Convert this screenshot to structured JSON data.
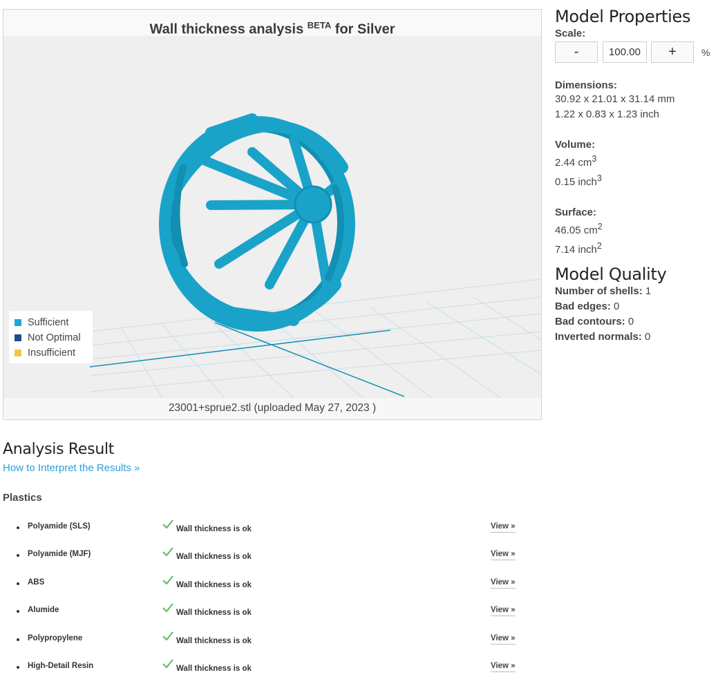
{
  "viewer": {
    "title_main": "Wall thickness analysis",
    "title_sup": "BETA",
    "title_suffix": "for Silver",
    "legend": [
      {
        "label": "Sufficient",
        "color": "#1aa8d9"
      },
      {
        "label": "Not Optimal",
        "color": "#1c4f8f"
      },
      {
        "label": "Insufficient",
        "color": "#f2c744"
      }
    ],
    "footer": "23001+sprue2.stl (uploaded May 27, 2023 )",
    "model_color": "#1aa3c9"
  },
  "properties": {
    "heading": "Model Properties",
    "scale_label": "Scale:",
    "minus_label": "-",
    "scale_value": "100.00",
    "plus_label": "+",
    "percent": "%",
    "dimensions_label": "Dimensions:",
    "dimensions_mm": "30.92 x 21.01 x 31.14 mm",
    "dimensions_inch": "1.22 x 0.83 x 1.23 inch",
    "volume_label": "Volume:",
    "volume_cm": "2.44 cm",
    "volume_inch": "0.15 inch",
    "power": "3",
    "surface_label": "Surface:",
    "surface_cm": "46.05 cm",
    "surface_inch": "7.14 inch",
    "surface_power": "2"
  },
  "quality": {
    "heading": "Model Quality",
    "rows": [
      {
        "label": "Number of shells:",
        "value": "1"
      },
      {
        "label": "Bad edges:",
        "value": "0"
      },
      {
        "label": "Bad contours:",
        "value": "0"
      },
      {
        "label": "Inverted normals:",
        "value": "0"
      }
    ]
  },
  "analysis": {
    "heading": "Analysis Result",
    "link": "How to Interpret the Results »",
    "category": "Plastics",
    "view_label": "View »",
    "status": "Wall thickness is ok",
    "materials": [
      "Polyamide (SLS)",
      "Polyamide (MJF)",
      "ABS",
      "Alumide",
      "Polypropylene",
      "High-Detail Resin"
    ]
  }
}
